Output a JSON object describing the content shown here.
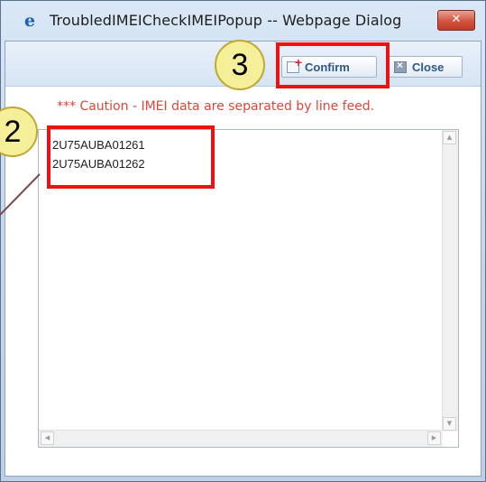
{
  "window": {
    "title": "TroubledIMEICheckIMEIPopup -- Webpage Dialog",
    "close_label": "✕"
  },
  "toolbar": {
    "confirm_label": "Confirm",
    "close_label": "Close"
  },
  "caution": "*** Caution - IMEI data are separated by line feed.",
  "imei_list": [
    "2U75AUBA01261",
    "2U75AUBA01262"
  ],
  "annotations": {
    "badge_confirm": "3",
    "badge_list": "2"
  },
  "colors": {
    "highlight": "#ee1111",
    "caution_text": "#e0453a",
    "badge_fill": "#f6ef9a"
  },
  "icons": [
    "ie-icon",
    "window-close-icon",
    "confirm-icon",
    "close-icon"
  ]
}
